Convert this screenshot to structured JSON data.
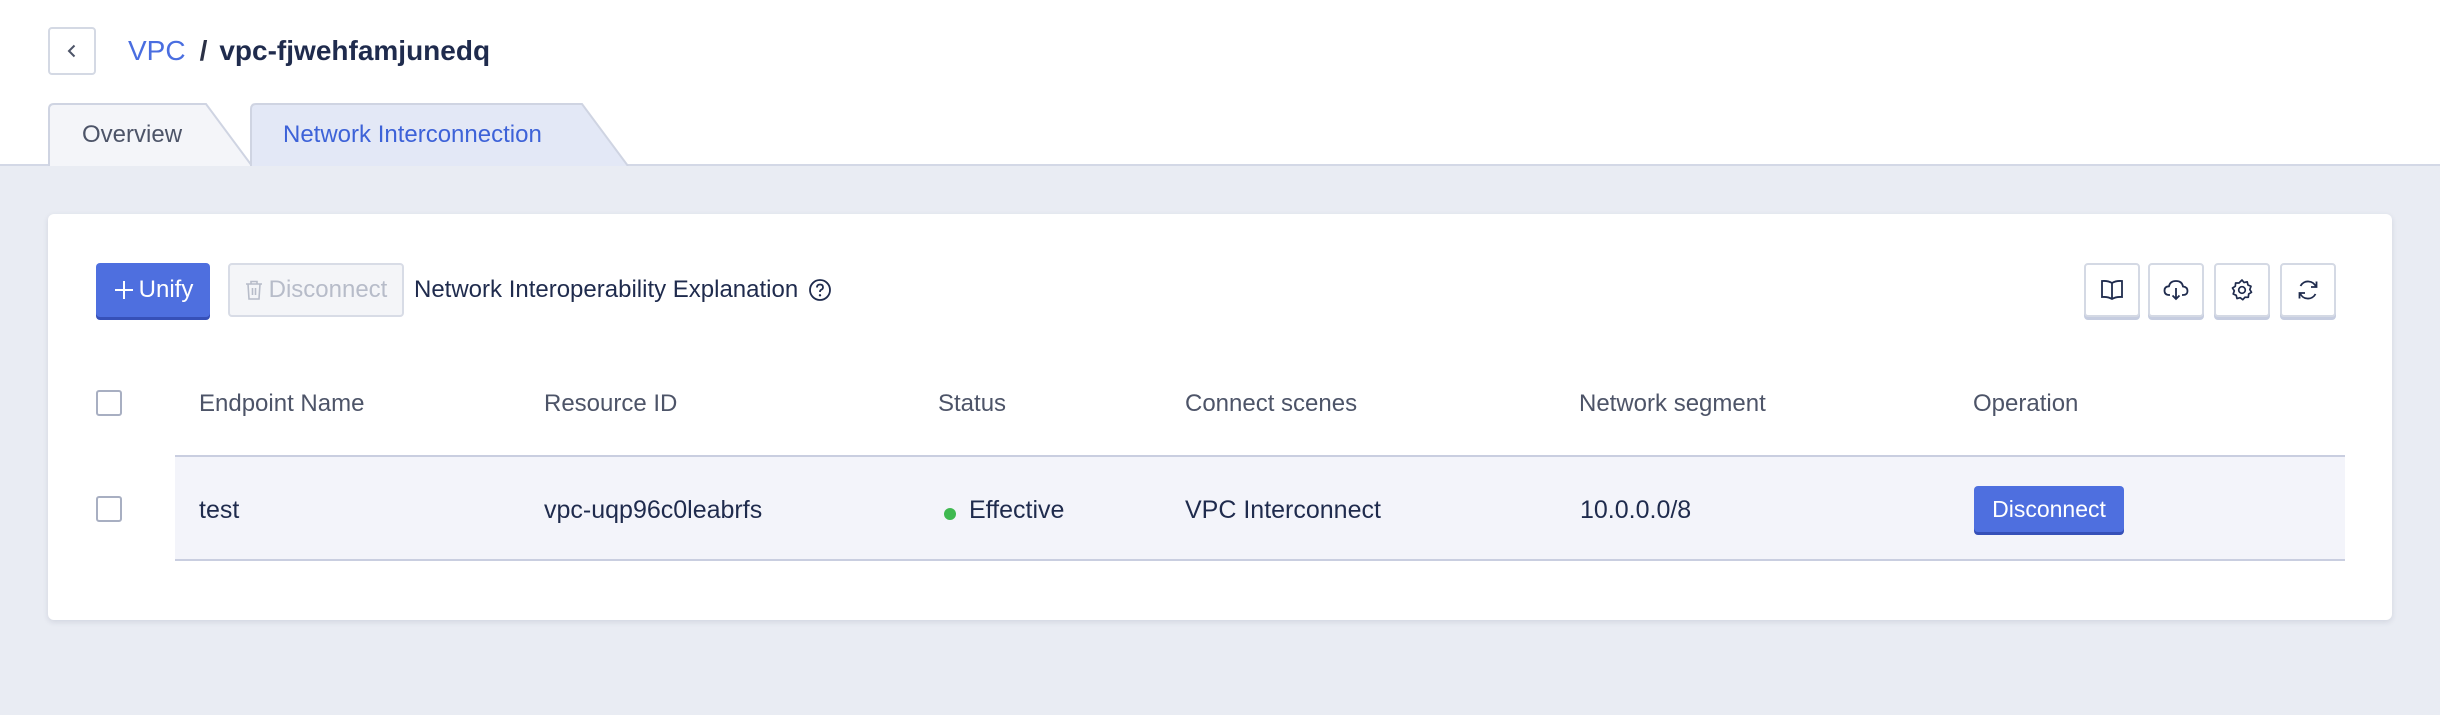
{
  "breadcrumb": {
    "parent": "VPC",
    "separator": "/",
    "current": "vpc-fjwehfamjunedq"
  },
  "tabs": [
    {
      "label": "Overview",
      "active": false
    },
    {
      "label": "Network Interconnection",
      "active": true
    }
  ],
  "toolbar": {
    "unify_label": "Unify",
    "disconnect_label": "Disconnect",
    "explanation_label": "Network Interoperability Explanation",
    "icons": [
      "book-icon",
      "cloud-download-icon",
      "settings-icon",
      "refresh-icon"
    ]
  },
  "table": {
    "headers": [
      "Endpoint Name",
      "Resource ID",
      "Status",
      "Connect scenes",
      "Network segment",
      "Operation"
    ],
    "rows": [
      {
        "endpoint_name": "test",
        "resource_id": "vpc-uqp96c0leabrfs",
        "status": "Effective",
        "connect_scene": "VPC Interconnect",
        "network_segment": "10.0.0.0/8",
        "operation_label": "Disconnect"
      }
    ]
  },
  "colors": {
    "accent": "#4e6fdf",
    "link": "#4a6ee0",
    "status_effective": "#3fb950",
    "page_bg": "#e9ecf3"
  }
}
